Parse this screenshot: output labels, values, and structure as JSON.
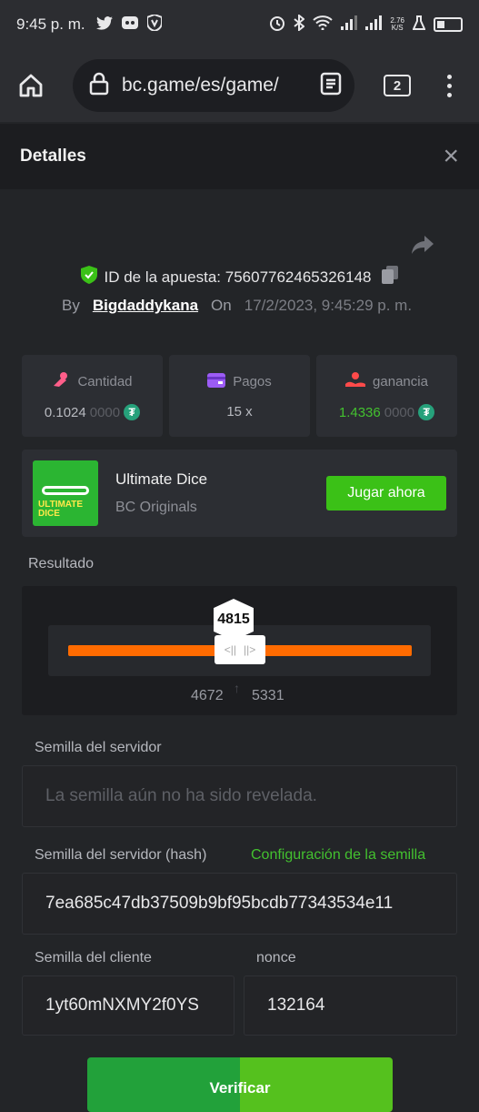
{
  "status_bar": {
    "time": "9:45 p. m.",
    "net_speed_value": "2.76",
    "net_speed_unit": "K/S",
    "left_icons": [
      "twitter-icon",
      "discord-icon",
      "shield-app-icon"
    ],
    "right_icons": [
      "alarm-icon",
      "bluetooth-icon",
      "wifi-icon",
      "signal-icon",
      "signal-icon",
      "flask-icon",
      "battery-icon"
    ]
  },
  "browser": {
    "url": "bc.game/es/game/",
    "tab_count": "2"
  },
  "modal": {
    "title": "Detalles",
    "close_label": "×"
  },
  "bet": {
    "id_label": "ID de la apuesta: 75607762465326148",
    "by_label": "By",
    "username": "Bigdaddykana",
    "on_label": "On",
    "date": "17/2/2023, 9:45:29 p. m."
  },
  "stats": [
    {
      "label": "Cantidad",
      "value_main": "0.1024",
      "value_dim": "0000",
      "icon": "money-bag-icon",
      "color": "#ff5e8a"
    },
    {
      "label": "Pagos",
      "value_main": "15 x",
      "value_dim": "",
      "icon": "wallet-icon",
      "color": "#9c5cf5"
    },
    {
      "label": "ganancia",
      "value_main": "1.4336",
      "value_dim": "0000",
      "icon": "profit-icon",
      "color": "#ff4a4a"
    }
  ],
  "game": {
    "name": "Ultimate Dice",
    "provider": "BC Originals",
    "play_label": "Jugar ahora",
    "thumb_text": "ULTIMATE DICE",
    "thumb_badge": "BIGDICE"
  },
  "result": {
    "label": "Resultado",
    "value": "4815",
    "range_low": "4672",
    "range_high": "5331"
  },
  "server_seed": {
    "label": "Semilla del servidor",
    "placeholder": "La semilla aún no ha sido revelada."
  },
  "server_seed_hash": {
    "label": "Semilla del servidor (hash)",
    "config_link": "Configuración de la semilla",
    "value": "7ea685c47db37509b9bf95bcdb77343534e11"
  },
  "client_seed": {
    "label": "Semilla del cliente",
    "value": "1yt60mNXMY2f0YS"
  },
  "nonce": {
    "label": "nonce",
    "value": "132164"
  },
  "verify_label": "Verificar",
  "colors": {
    "accent_green": "#3bc117",
    "slider_orange": "#ff6b00",
    "tether": "#26a17b"
  }
}
